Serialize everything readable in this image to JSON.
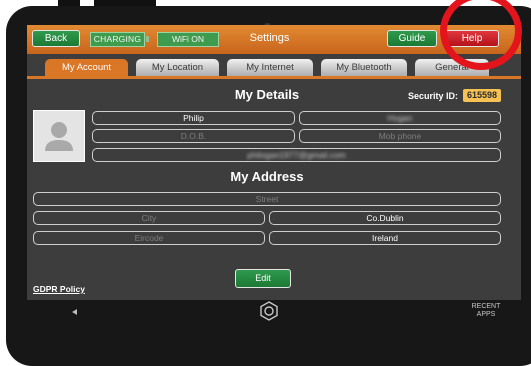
{
  "header": {
    "back_label": "Back",
    "charging_label": "CHARGING",
    "wifi_label": "WiFi ON",
    "title": "Settings",
    "guide_label": "Guide",
    "help_label": "Help"
  },
  "tabs": [
    {
      "label": "My Account",
      "active": true
    },
    {
      "label": "My Location",
      "active": false
    },
    {
      "label": "My Internet",
      "active": false
    },
    {
      "label": "My Bluetooth",
      "active": false
    },
    {
      "label": "General",
      "active": false
    }
  ],
  "details": {
    "heading": "My Details",
    "security_label": "Security ID:",
    "security_id": "615598",
    "first_name": "Philip",
    "last_name": "Hogan",
    "dob_placeholder": "D.O.B.",
    "mobile_placeholder": "Mob phone",
    "email": "philogan1977@gmail.com"
  },
  "address": {
    "heading": "My Address",
    "street_placeholder": "Street",
    "city_placeholder": "City",
    "county": "Co.Dublin",
    "eircode_placeholder": "Eircode",
    "country": "Ireland"
  },
  "actions": {
    "edit_label": "Edit",
    "gdpr_label": "GDPR Policy"
  },
  "navbar": {
    "recent_label": "RECENT APPS"
  },
  "colors": {
    "header_orange": "#d97726",
    "button_green": "#1c7a35",
    "help_red": "#b5121a",
    "security_badge": "#f6c254",
    "annotation_circle": "#e3141c"
  }
}
